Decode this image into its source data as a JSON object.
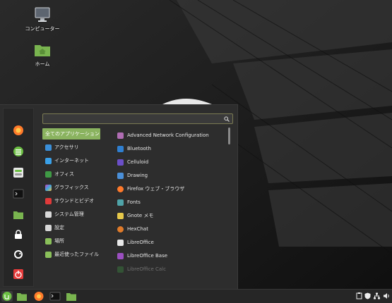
{
  "desktop": {
    "icons": [
      {
        "label": "コンピューター",
        "icon": "computer-icon"
      },
      {
        "label": "ホーム",
        "icon": "home-folder-icon"
      }
    ]
  },
  "menu": {
    "search": {
      "value": "",
      "placeholder": "",
      "icon": "search-icon"
    },
    "favorites": [
      {
        "name": "firefox",
        "icon": "firefox-icon",
        "color": "#ff7a2b"
      },
      {
        "name": "software-manager",
        "icon": "software-manager-icon",
        "color": "#6cbf43"
      },
      {
        "name": "settings",
        "icon": "settings-toggle-icon",
        "color": "#e8e8e8"
      },
      {
        "name": "terminal",
        "icon": "terminal-icon",
        "color": "#1e1e1e"
      },
      {
        "name": "files",
        "icon": "folder-icon",
        "color": "#79b44f"
      },
      {
        "name": "lock",
        "icon": "lock-icon",
        "color": "#ffffff"
      },
      {
        "name": "logout",
        "icon": "logout-icon",
        "color": "#ffffff"
      },
      {
        "name": "shutdown",
        "icon": "power-icon",
        "color": "#e53a3a"
      }
    ],
    "categories": [
      {
        "label": "全てのアプリケーション",
        "icon": "",
        "color": ""
      },
      {
        "label": "アクセサリ",
        "icon": "accessories-icon",
        "color": "#3a8fd9"
      },
      {
        "label": "インターネット",
        "icon": "internet-icon",
        "color": "#3aa0e8"
      },
      {
        "label": "オフィス",
        "icon": "office-icon",
        "color": "#3f9a45"
      },
      {
        "label": "グラフィックス",
        "icon": "graphics-icon",
        "color": "#c63fb8"
      },
      {
        "label": "サウンドとビデオ",
        "icon": "sound-video-icon",
        "color": "#e03a3a"
      },
      {
        "label": "システム管理",
        "icon": "system-admin-icon",
        "color": "#d8d8d8"
      },
      {
        "label": "設定",
        "icon": "preferences-icon",
        "color": "#d8d8d8"
      },
      {
        "label": "場所",
        "icon": "places-folder-icon",
        "color": "#8ac05a"
      },
      {
        "label": "最近使ったファイル",
        "icon": "recent-files-folder-icon",
        "color": "#8ac05a"
      }
    ],
    "apps": [
      {
        "label": "Advanced Network Configuration",
        "icon": "network-config-icon",
        "color": "#b06db3"
      },
      {
        "label": "Bluetooth",
        "icon": "bluetooth-icon",
        "color": "#2f7fd0"
      },
      {
        "label": "Celluloid",
        "icon": "celluloid-icon",
        "color": "#6b4fc8"
      },
      {
        "label": "Drawing",
        "icon": "drawing-icon",
        "color": "#4a8fd8"
      },
      {
        "label": "Firefox ウェブ・ブラウザ",
        "icon": "firefox-icon",
        "color": "#ff7a2b"
      },
      {
        "label": "Fonts",
        "icon": "fonts-icon",
        "color": "#4fa3a8"
      },
      {
        "label": "Gnote メモ",
        "icon": "gnote-icon",
        "color": "#e6c84a"
      },
      {
        "label": "HexChat",
        "icon": "hexchat-icon",
        "color": "#e07b2a"
      },
      {
        "label": "LibreOffice",
        "icon": "libreoffice-icon",
        "color": "#e8e8e8"
      },
      {
        "label": "LibreOffice Base",
        "icon": "libreoffice-base-icon",
        "color": "#9b4fc0"
      },
      {
        "label": "LibreOffice Calc",
        "icon": "libreoffice-calc-icon",
        "color": "#3f9a45"
      }
    ]
  },
  "panel": {
    "launchers": [
      {
        "name": "menu",
        "icon": "mint-menu-icon",
        "color": "#6cbf43"
      },
      {
        "name": "show-desktop",
        "icon": "folder-icon",
        "color": "#79b44f"
      },
      {
        "name": "firefox",
        "icon": "firefox-icon",
        "color": "#ff7a2b"
      },
      {
        "name": "terminal",
        "icon": "terminal-icon",
        "color": "#1e1e1e"
      },
      {
        "name": "files",
        "icon": "folder-icon",
        "color": "#79b44f"
      }
    ],
    "tray": [
      {
        "name": "clipboard",
        "icon": "clipboard-icon"
      },
      {
        "name": "shield",
        "icon": "shield-icon"
      },
      {
        "name": "network",
        "icon": "network-icon"
      },
      {
        "name": "volume",
        "icon": "volume-icon"
      }
    ]
  }
}
